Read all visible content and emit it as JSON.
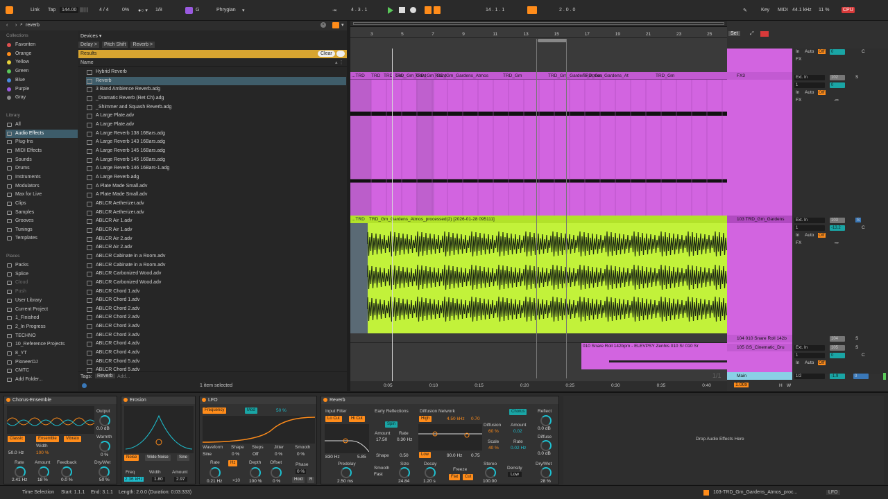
{
  "transport": {
    "link": "Link",
    "tap": "Tap",
    "tempo": "144.00",
    "signature": "4 / 4",
    "cpu_pct": "0%",
    "quantize": "1/8",
    "key": "G",
    "scale": "Phrygian",
    "position": "4 .  3 .  1",
    "loop_start": "14 .  1 .  1",
    "loop_length": "2 .  0 .  0",
    "key_label": "Key",
    "midi_label": "MIDI",
    "sample_rate": "44.1 kHz",
    "load": "11 %",
    "cpu_label": "CPU"
  },
  "browser": {
    "search_value": "reverb",
    "collections_label": "Collections",
    "collections": [
      {
        "label": "Favoriten",
        "color": "#e05050"
      },
      {
        "label": "Orange",
        "color": "#ff8c1a"
      },
      {
        "label": "Yellow",
        "color": "#e8d23a"
      },
      {
        "label": "Green",
        "color": "#5ac85a"
      },
      {
        "label": "Blue",
        "color": "#4a8ae0"
      },
      {
        "label": "Purple",
        "color": "#9a5ae0"
      },
      {
        "label": "Gray",
        "color": "#8a8a8a"
      }
    ],
    "library_label": "Library",
    "library": [
      "All",
      "Audio Effects",
      "Plug-Ins",
      "MIDI Effects",
      "Sounds",
      "Drums",
      "Instruments",
      "Modulators",
      "Max for Live",
      "Clips",
      "Samples",
      "Grooves",
      "Tunings",
      "Templates"
    ],
    "places_label": "Places",
    "places": [
      "Packs",
      "Splice",
      "Cloud",
      "Push",
      "User Library",
      "Current Project",
      "1_Finished",
      "2_In Progress",
      "TECHNO",
      "10_Reference Projects",
      "8_YT",
      "PioneerDJ",
      "CMTC",
      "Add Folder..."
    ],
    "devices_label": "Devices ▾",
    "breadcrumbs": [
      "Delay >",
      "Pitch Shift",
      "Reverb >"
    ],
    "results_label": "Results",
    "clear_label": "Clear",
    "name_col": "Name",
    "items": [
      "Hybrid Reverb",
      "Reverb",
      "3 Band Ambience Reverb.adg",
      "_Dramatic Reverb (Ret Ch).adg",
      "_Shimmer and Squash Reverb.adg",
      "A Large Plate.adv",
      "A Large Plate.adv",
      "A Large Reverb 138 16Bars.adg",
      "A Large Reverb 143 16Bars.adg",
      "A Large Reverb 145 16Bars.adg",
      "A Large Reverb 145 16Bars.adg",
      "A Large Reverb 146 16Bars-1.adg",
      "A Large Reverb.adg",
      "A Plate Made Small.adv",
      "A Plate Made Small.adv",
      "ABLCR Aetherizer.adv",
      "ABLCR Aetherizer.adv",
      "ABLCR Air 1.adv",
      "ABLCR Air 1.adv",
      "ABLCR Air 2.adv",
      "ABLCR Air 2.adv",
      "ABLCR Cabinate in a Room.adv",
      "ABLCR Cabinate in a Room.adv",
      "ABLCR Carbonized Wood.adv",
      "ABLCR Carbonized Wood.adv",
      "ABLCR Chord 1.adv",
      "ABLCR Chord 1.adv",
      "ABLCR Chord 2.adv",
      "ABLCR Chord 2.adv",
      "ABLCR Chord 3.adv",
      "ABLCR Chord 3.adv",
      "ABLCR Chord 4.adv",
      "ABLCR Chord 4.adv",
      "ABLCR Chord 5.adv",
      "ABLCR Chord 5.adv"
    ],
    "tags_label": "Tags:",
    "tag": "Reverb",
    "tag_add": "Add...",
    "selection_status": "1 item selected"
  },
  "arrangement": {
    "bar_numbers": [
      "3",
      "5",
      "7",
      "9",
      "11",
      "13",
      "15",
      "17",
      "19",
      "21",
      "23",
      "25"
    ],
    "time_labels": [
      "0:05",
      "0:10",
      "0:15",
      "0:20",
      "0:25",
      "0:30",
      "0:35",
      "0:40"
    ],
    "clip_pink_labels": [
      "...TRD",
      "TRD",
      "TRD_Gm_",
      "TRD_Gm_Gard",
      "TRD_Gm_Gard",
      "TRD_Gm_Gardens_Atmos",
      "TRD_Gm",
      "TRD_Gm_Gardens_Atmos",
      "TRD_Gm_Gardens_At",
      "TRD_Gm"
    ],
    "clip_green_label": "TRD_Gm_Gardens_Atmos_processed(2) [2026-01-28 095111]",
    "clip_green_prefix": "...TRD",
    "clip_snare_label": "010 Snare Roll 142bpm - ELEVPSY Zenhis 010 Sr 010 Sr",
    "page_indicator": "1/1",
    "zoom": "1.00x",
    "h_label": "H",
    "w_label": "W"
  },
  "mixer": {
    "set_label": "Set",
    "tracks": [
      {
        "name": "FX3",
        "input": "Ext. In",
        "channel": "1",
        "num": "102",
        "vol": "0",
        "pan": "C"
      },
      {
        "name": "103 TRD_Gm_Gardens",
        "input": "Ext. In",
        "channel": "1",
        "num": "103",
        "vol": "-13.2",
        "pan": "C"
      },
      {
        "name": "104 010 Snare Roll 142b",
        "num": "104"
      },
      {
        "name": "105 GS_Cinematic_Dru",
        "input": "Ext. In",
        "channel": "1",
        "num": "105",
        "vol": "0",
        "pan": "C"
      },
      {
        "name": "Main",
        "channel": "1/2",
        "vol": "-1.9",
        "pan": "0"
      }
    ],
    "auto_label": "Auto",
    "off_label": "Off",
    "in_label": "In",
    "fx_label": "FX",
    "minus_inf": "-∞",
    "s_label": "S"
  },
  "devices": {
    "chorus": {
      "title": "Chorus-Ensemble",
      "output_label": "Output",
      "output": "0.0 dB",
      "warmth_label": "Warmth",
      "warmth": "0 %",
      "modes": [
        "Classic",
        "Ensemble",
        "Vibrato"
      ],
      "width_label": "Width",
      "width": "100 %",
      "freq": "50.0 Hz",
      "rate_label": "Rate",
      "rate": "2.41 Hz",
      "amount_label": "Amount",
      "amount": "18 %",
      "feedback_label": "Feedback",
      "feedback": "0.0 %",
      "drywet_label": "Dry/Wet",
      "drywet": "50 %"
    },
    "erosion": {
      "title": "Erosion",
      "modes": [
        "Noise",
        "Wide Noise",
        "Sine"
      ],
      "freq_label": "Freq",
      "freq": "2.36 kHz",
      "width_label": "Width",
      "width": "1.80",
      "amount_label": "Amount",
      "amount": "2.97"
    },
    "lfo": {
      "title": "LFO",
      "frequency_label": "Frequency",
      "mod_label": "Mod",
      "pct": "50 %",
      "waveform_label": "Waveform",
      "waveform": "Sine",
      "shape_label": "Shape",
      "shape": "0 %",
      "steps_label": "Steps",
      "steps": "Off",
      "jitter_label": "Jitter",
      "jitter": "0 %",
      "smooth_label": "Smooth",
      "smooth": "0 %",
      "rate_label": "Rate",
      "rate": "0.21 Hz",
      "hz_label": "Hz",
      "x10": "×10",
      "depth_label": "Depth",
      "depth": "100 %",
      "offset_label": "Offset",
      "offset": "0 %",
      "phase_label": "Phase",
      "phase": "0 %",
      "hold_label": "Hold",
      "r_label": "R"
    },
    "reverb": {
      "title": "Reverb",
      "input_filter": "Input Filter",
      "locut": "Lo Cut",
      "hicut": "Hi Cut",
      "lf": "830 Hz",
      "hf": "5.85",
      "early_label": "Early Reflections",
      "spin": "Spin",
      "amount_label": "Amount",
      "amount": "17.50",
      "rate_label": "Rate",
      "rate": "0.30 Hz",
      "shape_label": "Shape",
      "shape": "0.50",
      "diffusion_label": "Diffusion Network",
      "high": "High",
      "freq_hi": "4.50 kHz",
      "hi_val": "0.70",
      "low": "Low",
      "freq_lo": "90.0 Hz",
      "lo_val": "0.75",
      "diffusion": "Diffusion",
      "diffusion_val": "60 %",
      "scale": "Scale",
      "scale_val": "40 %",
      "chorus": "Chorus",
      "ch_amount": "Amount",
      "ch_amount_val": "0.02",
      "ch_rate": "Rate",
      "ch_rate_val": "0.02 Hz",
      "reflect_label": "Reflect",
      "reflect": "0.0 dB",
      "diffuse_label": "Diffuse",
      "diffuse": "0.0 dB",
      "predelay_label": "Predelay",
      "predelay": "2.50 ms",
      "smooth_label": "Smooth",
      "smooth": "Fast",
      "size_label": "Size",
      "size": "24.84",
      "decay_label": "Decay",
      "decay": "1.20 s",
      "freeze_label": "Freeze",
      "flat": "Flat",
      "cut": "Cut",
      "stereo_label": "Stereo",
      "stereo": "100.00",
      "density_label": "Density",
      "density": "Low",
      "drywet_label": "Dry/Wet",
      "drywet": "28 %"
    },
    "drop_label": "Drop Audio Effects Here"
  },
  "statusbar": {
    "mode": "Time Selection",
    "start": "Start: 1.1.1",
    "end": "End: 3.1.1",
    "length": "Length: 2.0.0 (Duration: 0:03:333)",
    "clip_name": "103-TRD_Gm_Gardens_Atmos_proc...",
    "lfo": "LFO"
  }
}
